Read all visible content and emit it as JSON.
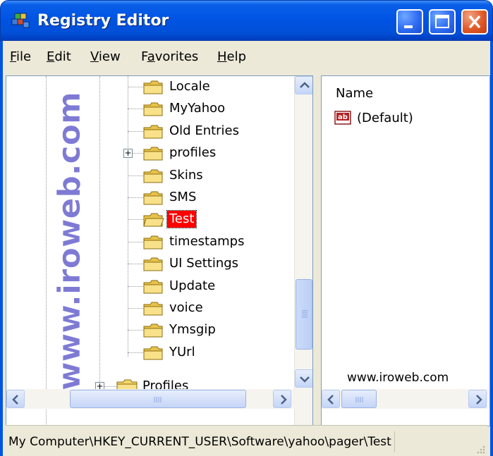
{
  "window": {
    "title": "Registry Editor",
    "icon": "registry-editor-icon"
  },
  "menu": {
    "items": [
      {
        "label": "File",
        "accel": "F"
      },
      {
        "label": "Edit",
        "accel": "E"
      },
      {
        "label": "View",
        "accel": "V"
      },
      {
        "label": "Favorites",
        "accel": "a"
      },
      {
        "label": "Help",
        "accel": "H"
      }
    ]
  },
  "tree": {
    "watermark": "www.iroweb.com",
    "items": [
      {
        "label": "Locale",
        "expandable": false,
        "selected": false
      },
      {
        "label": "MyYahoo",
        "expandable": false,
        "selected": false
      },
      {
        "label": "Old Entries",
        "expandable": false,
        "selected": false
      },
      {
        "label": "profiles",
        "expandable": true,
        "selected": false
      },
      {
        "label": "Skins",
        "expandable": false,
        "selected": false
      },
      {
        "label": "SMS",
        "expandable": false,
        "selected": false
      },
      {
        "label": "Test",
        "expandable": false,
        "selected": true
      },
      {
        "label": "timestamps",
        "expandable": false,
        "selected": false
      },
      {
        "label": "UI Settings",
        "expandable": false,
        "selected": false
      },
      {
        "label": "Update",
        "expandable": false,
        "selected": false
      },
      {
        "label": "voice",
        "expandable": false,
        "selected": false
      },
      {
        "label": "Ymsgip",
        "expandable": false,
        "selected": false
      },
      {
        "label": "YUrl",
        "expandable": false,
        "selected": false
      }
    ],
    "parent_item": {
      "label": "Profiles",
      "expandable": true
    }
  },
  "list": {
    "column_name": "Name",
    "values": [
      {
        "name": "(Default)",
        "icon": "string-value-icon"
      }
    ],
    "watermark": "www.iroweb.com"
  },
  "status": {
    "path": "My Computer\\HKEY_CURRENT_USER\\Software\\yahoo\\pager\\Test"
  },
  "colors": {
    "titlebar": "#0054e3",
    "selection": "#ff0000",
    "watermark": "#5a55c8"
  }
}
